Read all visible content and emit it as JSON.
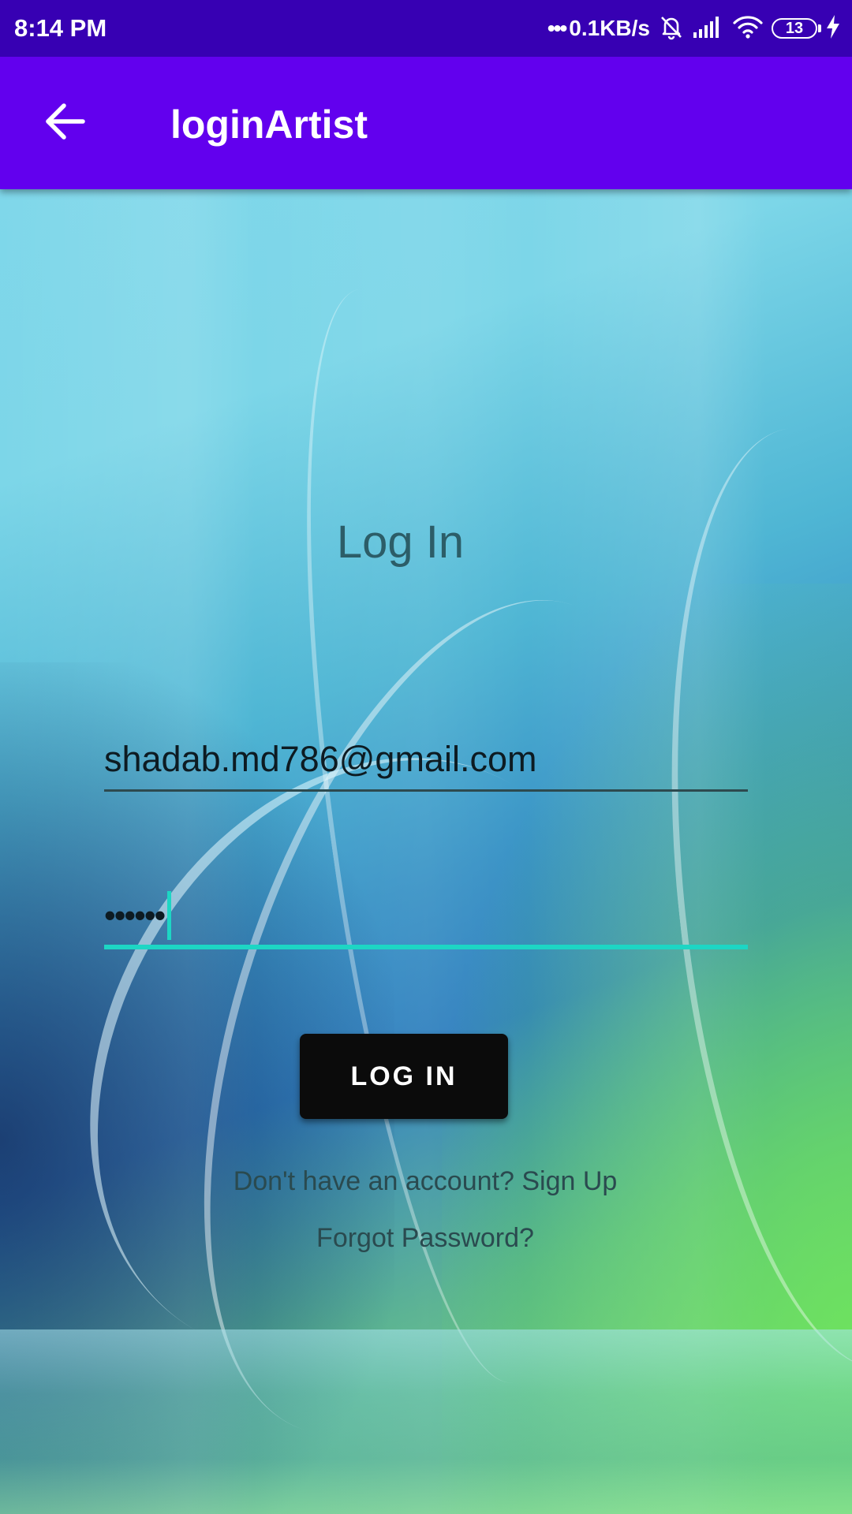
{
  "status_bar": {
    "time": "8:14 PM",
    "dots": "•••",
    "network_speed": "0.1KB/s",
    "battery_level": "13",
    "icons": [
      "mute-bell-icon",
      "signal-icon",
      "wifi-icon",
      "battery-icon",
      "charging-icon"
    ]
  },
  "app_bar": {
    "title": "loginArtist",
    "back_icon": "arrow-back-icon"
  },
  "form": {
    "heading": "Log In",
    "email_value": "shadab.md786@gmail.com",
    "password_value": "••••••",
    "login_button_label": "LOG IN",
    "signup_text": "Don't have an account? Sign Up",
    "forgot_text": "Forgot Password?"
  },
  "colors": {
    "status_bar": "#3700b3",
    "app_bar": "#6200ee",
    "focus_accent": "#1dd6c4",
    "button": "#0b0b0b"
  }
}
